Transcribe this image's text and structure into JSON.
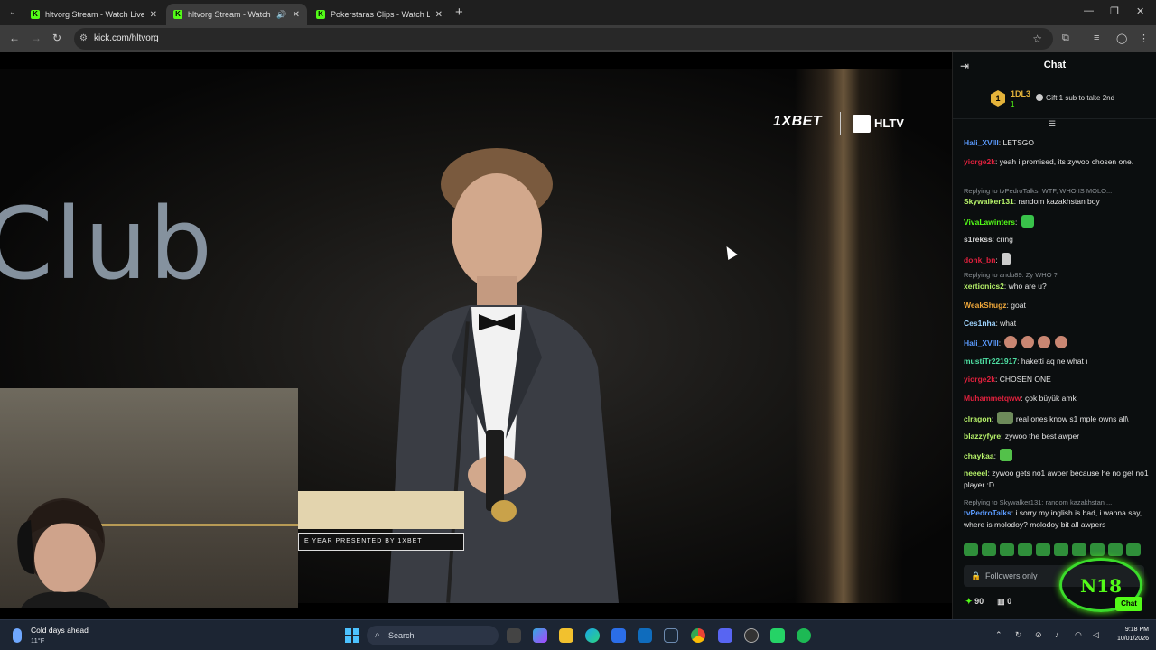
{
  "browser": {
    "tabs": [
      {
        "title": "hltvorg Stream - Watch Live on",
        "active": false,
        "audio": false
      },
      {
        "title": "hltvorg Stream - Watch Live",
        "active": true,
        "audio": true
      },
      {
        "title": "Pokerstaras Clips - Watch Live",
        "active": false,
        "audio": false
      }
    ],
    "url": "kick.com/hltvorg",
    "favicon_letter": "K"
  },
  "video": {
    "backdrop_text": "Club",
    "sponsor_text": "1XBET",
    "hltv_text": "HLTV",
    "lower_third_caption": "E YEAR PRESENTED BY 1XBET"
  },
  "chat": {
    "title": "Chat",
    "leaderboard": {
      "rank": "1",
      "name": "1DL3",
      "count": "1",
      "gift_text": "Gift 1 sub to take 2nd"
    },
    "messages": [
      {
        "user": "Hali_XVIII",
        "color": "#5b9bff",
        "text": "LETSGO"
      },
      {
        "user": "yiorge2k",
        "color": "#e0213d",
        "text": "yeah i promised, its zywoo chosen one."
      },
      {
        "reply": "Replying to tvPedroTalks: WTF, WHO IS MOLO..."
      },
      {
        "user": "Skywalker131",
        "color": "#b7f36a",
        "text": "random kazakhstan boy"
      },
      {
        "user": "VivaLawinters",
        "color": "#53fc18",
        "text": "",
        "emote": "#39c24a"
      },
      {
        "user": "s1rekss",
        "color": "#d8d8d8",
        "text": "cring"
      },
      {
        "user": "donk_bn",
        "color": "#e0213d",
        "text": "",
        "emote": "#cccccc"
      },
      {
        "reply": "Replying to andu89: Zy WHO ?"
      },
      {
        "user": "xertionics2",
        "color": "#b7f36a",
        "text": "who are u?"
      },
      {
        "user": "WeakShugz",
        "color": "#f2a93b",
        "text": "goat"
      },
      {
        "user": "Ces1nha",
        "color": "#9fd4ff",
        "text": "what"
      },
      {
        "user": "Hali_XVIII",
        "color": "#5b9bff",
        "text": "",
        "emotes": 4
      },
      {
        "user": "mustiTr221917",
        "color": "#4fe0a4",
        "text": "haketti aq ne what ı"
      },
      {
        "user": "yiorge2k",
        "color": "#e0213d",
        "text": "CHOSEN ONE"
      },
      {
        "user": "Muhammetqww",
        "color": "#e0213d",
        "text": "çok büyük amk"
      },
      {
        "user": "clragon",
        "color": "#b7f36a",
        "text": "real ones know s1 mple owns all\\",
        "emote": "#6d8a5a"
      },
      {
        "user": "blazzyfyre",
        "color": "#b7f36a",
        "text": "zywoo the best awper"
      },
      {
        "user": "chaykaa",
        "color": "#b7f36a",
        "text": "",
        "emote": "#53c14a"
      },
      {
        "user": "neeeel",
        "color": "#b7f36a",
        "text": "zywoo gets no1 awper because he no get no1 player :D"
      },
      {
        "reply": "Replying to Skywalker131: random kazakhstan ..."
      },
      {
        "user": "tvPedroTalks",
        "color": "#5b9bff",
        "text": "i sorry my inglish is bad, i wanna say, where is molodoy? molodoy bit all awpers"
      }
    ],
    "input_placeholder": "Followers only",
    "points": "90",
    "gifts": "0",
    "send_label": "Chat",
    "overlay_badge": "N18"
  },
  "taskbar": {
    "weather_title": "Cold days ahead",
    "weather_temp": "11°F",
    "search_placeholder": "Search",
    "time": "9:18 PM",
    "date": "10/01/2026"
  }
}
